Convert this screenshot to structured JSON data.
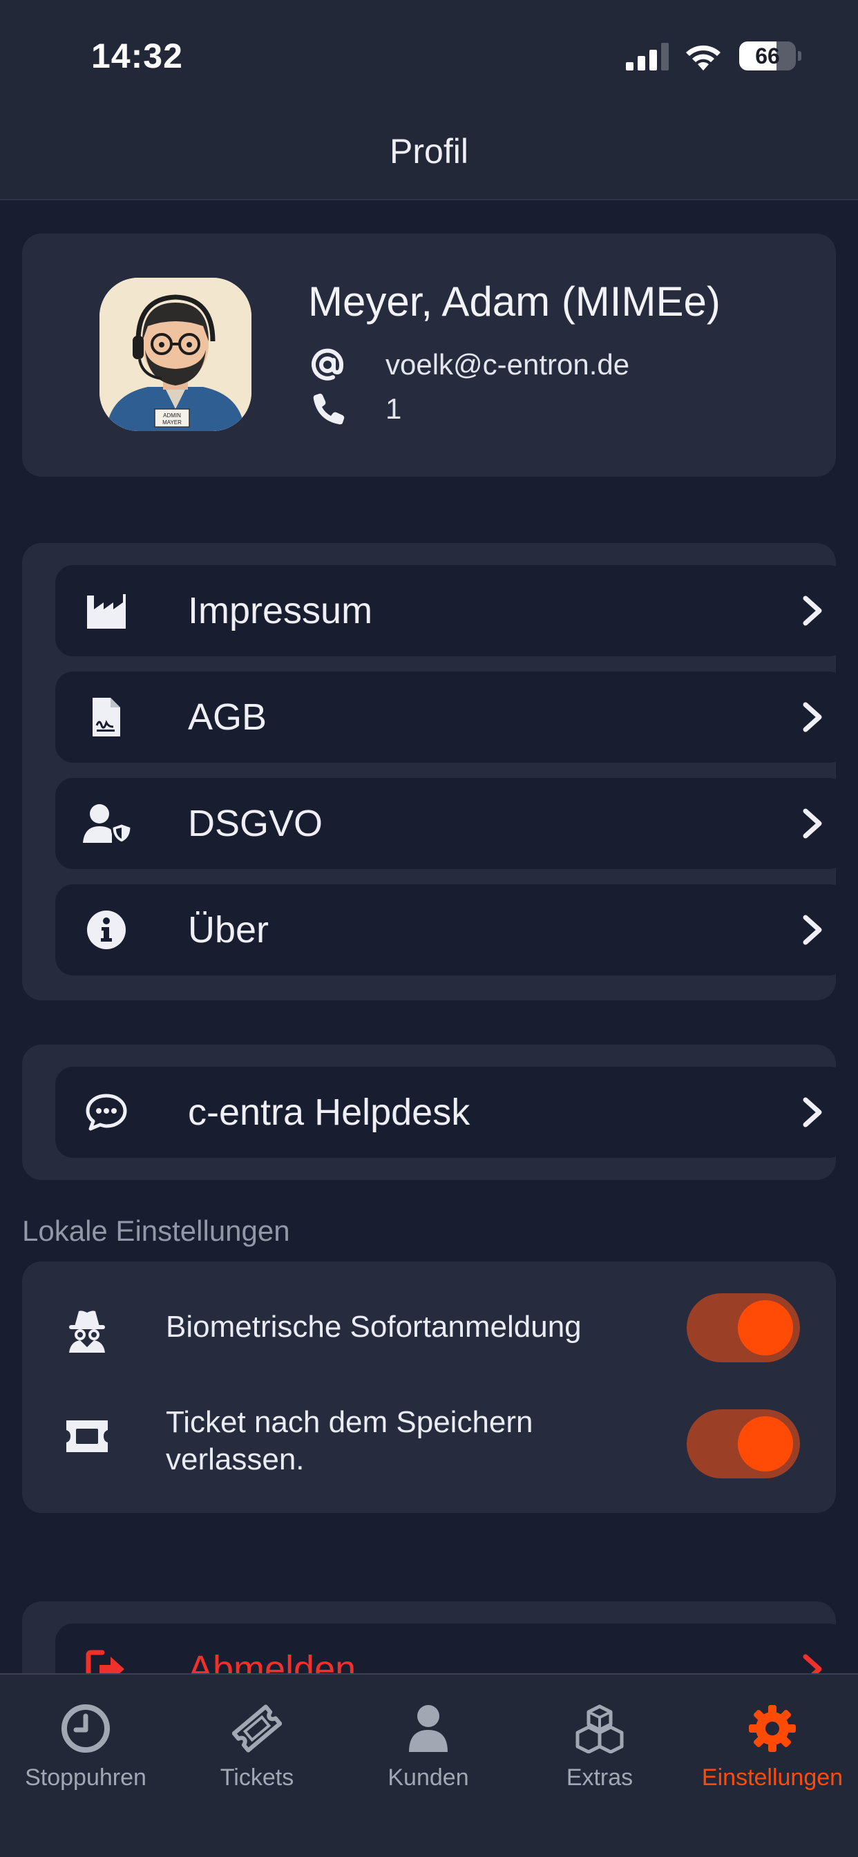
{
  "status_bar": {
    "time": "14:32",
    "battery": "66",
    "battery_level": 0.66
  },
  "header": {
    "title": "Profil"
  },
  "profile": {
    "name": "Meyer, Adam (MIMEe)",
    "email_icon": "at-icon",
    "email": "voelk@c-entron.de",
    "phone_icon": "phone-icon",
    "phone": "1",
    "avatar_badge": "ADMIN MAYER"
  },
  "menu": {
    "items": [
      {
        "label": "Impressum",
        "icon": "factory-icon"
      },
      {
        "label": "AGB",
        "icon": "contract-document-icon"
      },
      {
        "label": "DSGVO",
        "icon": "user-shield-icon"
      },
      {
        "label": "Über",
        "icon": "info-icon"
      }
    ]
  },
  "helpdesk": {
    "label": "c-entra Helpdesk",
    "icon": "chat-bubble-icon"
  },
  "local_settings": {
    "title": "Lokale Einstellungen",
    "items": [
      {
        "label": "Biometrische Sofortanmeldung",
        "icon": "incognito-icon",
        "enabled": true
      },
      {
        "label_line1": "Ticket nach dem Speichern",
        "label_line2": "verlassen.",
        "icon": "ticket-icon",
        "enabled": true
      }
    ]
  },
  "logout": {
    "label": "Abmelden",
    "icon": "logout-icon"
  },
  "tabs": [
    {
      "label": "Stoppuhren",
      "icon": "clock-icon",
      "active": false
    },
    {
      "label": "Tickets",
      "icon": "ticket-icon",
      "active": false
    },
    {
      "label": "Kunden",
      "icon": "person-icon",
      "active": false
    },
    {
      "label": "Extras",
      "icon": "cubes-icon",
      "active": false
    },
    {
      "label": "Einstellungen",
      "icon": "gear-icon",
      "active": true
    }
  ],
  "colors": {
    "accent": "#ff4b05",
    "logout": "#f0312b",
    "background": "#181d2f",
    "card": "#262b3e"
  }
}
